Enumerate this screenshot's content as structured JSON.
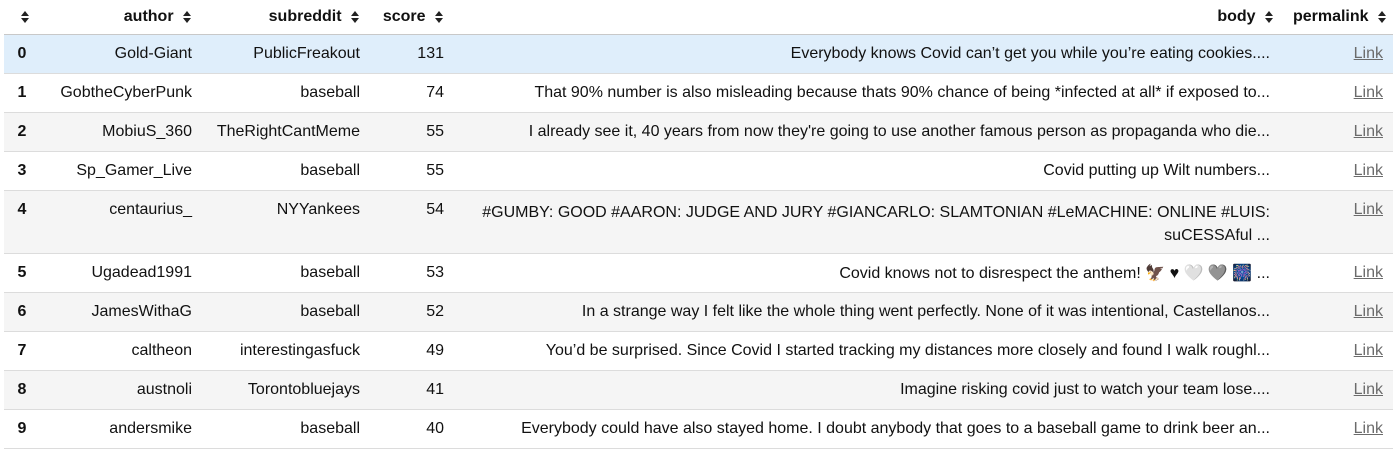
{
  "table": {
    "columns": {
      "index": "",
      "author": "author",
      "subreddit": "subreddit",
      "score": "score",
      "body": "body",
      "permalink": "permalink"
    },
    "selected_row": 0,
    "rows": [
      {
        "index": "0",
        "author": "Gold-Giant",
        "subreddit": "PublicFreakout",
        "score": "131",
        "body": "Everybody knows Covid can’t get you while you’re eating cookies....",
        "permalink": "Link"
      },
      {
        "index": "1",
        "author": "GobtheCyberPunk",
        "subreddit": "baseball",
        "score": "74",
        "body": "That 90% number is also misleading because thats 90% chance of being *infected at all* if exposed to...",
        "permalink": "Link"
      },
      {
        "index": "2",
        "author": "MobiuS_360",
        "subreddit": "TheRightCantMeme",
        "score": "55",
        "body": "I already see it, 40 years from now they're going to use another famous person as propaganda who die...",
        "permalink": "Link"
      },
      {
        "index": "3",
        "author": "Sp_Gamer_Live",
        "subreddit": "baseball",
        "score": "55",
        "body": "Covid putting up Wilt numbers...",
        "permalink": "Link"
      },
      {
        "index": "4",
        "author": "centaurius_",
        "subreddit": "NYYankees",
        "score": "54",
        "body": "#GUMBY: GOOD #AARON: JUDGE AND JURY #GIANCARLO: SLAMTONIAN #LeMACHINE: ONLINE #LUIS: suCESSAful ...",
        "permalink": "Link"
      },
      {
        "index": "5",
        "author": "Ugadead1991",
        "subreddit": "baseball",
        "score": "53",
        "body": "Covid knows not to disrespect the anthem! 🦅 ♥ 🤍 🩶 🎆 ...",
        "permalink": "Link"
      },
      {
        "index": "6",
        "author": "JamesWithaG",
        "subreddit": "baseball",
        "score": "52",
        "body": "In a strange way I felt like the whole thing went perfectly. None of it was intentional, Castellanos...",
        "permalink": "Link"
      },
      {
        "index": "7",
        "author": "caltheon",
        "subreddit": "interestingasfuck",
        "score": "49",
        "body": "You’d be surprised. Since Covid I started tracking my distances more closely and found I walk roughl...",
        "permalink": "Link"
      },
      {
        "index": "8",
        "author": "austnoli",
        "subreddit": "Torontobluejays",
        "score": "41",
        "body": "Imagine risking covid just to watch your team lose....",
        "permalink": "Link"
      },
      {
        "index": "9",
        "author": "andersmike",
        "subreddit": "baseball",
        "score": "40",
        "body": "Everybody could have also stayed home. I doubt anybody that goes to a baseball game to drink beer an...",
        "permalink": "Link"
      }
    ]
  }
}
